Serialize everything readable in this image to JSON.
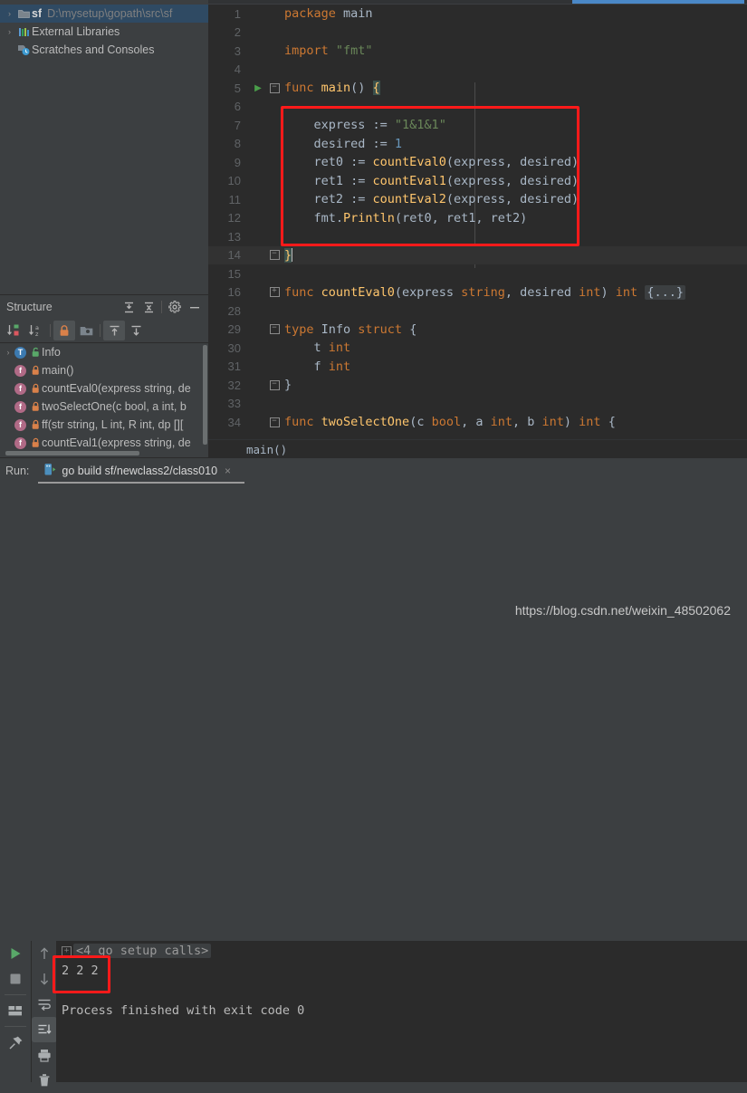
{
  "window": {
    "theme_bg": "#3c3f41",
    "editor_bg": "#2b2b2b",
    "accent": "#4a88c7",
    "annotation_color": "#ff1a1a"
  },
  "project_tree": {
    "items": [
      {
        "arrow": "›",
        "icon": "folder-icon",
        "name": "sf",
        "path": "D:\\mysetup\\gopath\\src\\sf",
        "selected": true
      },
      {
        "arrow": "›",
        "icon": "library-icon",
        "name": "External Libraries",
        "path": "",
        "selected": false
      },
      {
        "arrow": "",
        "icon": "scratches-icon",
        "name": "Scratches and Consoles",
        "path": "",
        "selected": false
      }
    ]
  },
  "structure": {
    "title": "Structure",
    "header_buttons": [
      {
        "name": "expand-all-icon",
        "label": "Expand All"
      },
      {
        "name": "collapse-all-icon",
        "label": "Collapse All"
      },
      {
        "name": "gear-icon",
        "label": "Settings"
      },
      {
        "name": "minimize-icon",
        "label": "Hide"
      }
    ],
    "toolbar_buttons": [
      {
        "name": "sort-by-visibility-icon",
        "label": "Sort by Visibility",
        "active": false
      },
      {
        "name": "sort-alphabetically-icon",
        "label": "Sort Alphabetically",
        "active": false
      },
      {
        "name": "show-non-public-icon",
        "label": "Show Non-Public",
        "active": true
      },
      {
        "name": "group-by-file-icon",
        "label": "Group by File",
        "active": false
      },
      {
        "name": "scroll-from-source-icon",
        "label": "Scroll from Source",
        "active": true
      },
      {
        "name": "scroll-to-source-icon",
        "label": "Scroll to Source",
        "active": false
      }
    ],
    "items": [
      {
        "arrow": "›",
        "kind": "T",
        "kind_class": "t",
        "lock": "public-icon",
        "label": "Info"
      },
      {
        "arrow": "",
        "kind": "f",
        "kind_class": "f",
        "lock": "private-icon",
        "label": "main()"
      },
      {
        "arrow": "",
        "kind": "f",
        "kind_class": "f",
        "lock": "private-icon",
        "label": "countEval0(express string, de"
      },
      {
        "arrow": "",
        "kind": "f",
        "kind_class": "f",
        "lock": "private-icon",
        "label": "twoSelectOne(c bool, a int, b"
      },
      {
        "arrow": "",
        "kind": "f",
        "kind_class": "f",
        "lock": "private-icon",
        "label": "ff(str string, L int, R int, dp []["
      },
      {
        "arrow": "",
        "kind": "f",
        "kind_class": "f",
        "lock": "private-icon",
        "label": "countEval1(express string, de"
      }
    ]
  },
  "editor": {
    "breadcrumb": "main()",
    "lines": [
      {
        "num": "1",
        "gutter": "",
        "fold": "",
        "caret": false,
        "tokens": [
          {
            "t": "package ",
            "c": "kw"
          },
          {
            "t": "main",
            "c": "pln"
          }
        ]
      },
      {
        "num": "2",
        "gutter": "",
        "fold": "",
        "caret": false,
        "tokens": []
      },
      {
        "num": "3",
        "gutter": "",
        "fold": "",
        "caret": false,
        "tokens": [
          {
            "t": "import ",
            "c": "kw"
          },
          {
            "t": "\"fmt\"",
            "c": "str"
          }
        ]
      },
      {
        "num": "4",
        "gutter": "",
        "fold": "",
        "caret": false,
        "tokens": []
      },
      {
        "num": "5",
        "gutter": "run-triangle-icon",
        "fold": "minus",
        "caret": false,
        "tokens": [
          {
            "t": "func ",
            "c": "kw"
          },
          {
            "t": "main",
            "c": "fn"
          },
          {
            "t": "() ",
            "c": "pln"
          },
          {
            "t": "{",
            "c": "brace"
          }
        ]
      },
      {
        "num": "6",
        "gutter": "",
        "fold": "",
        "caret": false,
        "tokens": []
      },
      {
        "num": "7",
        "gutter": "",
        "fold": "",
        "caret": false,
        "tokens": [
          {
            "t": "    express := ",
            "c": "pln"
          },
          {
            "t": "\"1&1&1\"",
            "c": "str"
          }
        ]
      },
      {
        "num": "8",
        "gutter": "",
        "fold": "",
        "caret": false,
        "tokens": [
          {
            "t": "    desired := ",
            "c": "pln"
          },
          {
            "t": "1",
            "c": "num"
          }
        ]
      },
      {
        "num": "9",
        "gutter": "",
        "fold": "",
        "caret": false,
        "tokens": [
          {
            "t": "    ret0 := ",
            "c": "pln"
          },
          {
            "t": "countEval0",
            "c": "fn"
          },
          {
            "t": "(express, desired)",
            "c": "pln"
          }
        ]
      },
      {
        "num": "10",
        "gutter": "",
        "fold": "",
        "caret": false,
        "tokens": [
          {
            "t": "    ret1 := ",
            "c": "pln"
          },
          {
            "t": "countEval1",
            "c": "fn"
          },
          {
            "t": "(express, desired)",
            "c": "pln"
          }
        ]
      },
      {
        "num": "11",
        "gutter": "",
        "fold": "",
        "caret": false,
        "tokens": [
          {
            "t": "    ret2 := ",
            "c": "pln"
          },
          {
            "t": "countEval2",
            "c": "fn"
          },
          {
            "t": "(express, desired)",
            "c": "pln"
          }
        ]
      },
      {
        "num": "12",
        "gutter": "",
        "fold": "",
        "caret": false,
        "tokens": [
          {
            "t": "    fmt.",
            "c": "pln"
          },
          {
            "t": "Println",
            "c": "fn"
          },
          {
            "t": "(ret0, ret1, ret2)",
            "c": "pln"
          }
        ]
      },
      {
        "num": "13",
        "gutter": "",
        "fold": "",
        "caret": false,
        "tokens": []
      },
      {
        "num": "14",
        "gutter": "",
        "fold": "minus",
        "caret": true,
        "tokens": [
          {
            "t": "}",
            "c": "brace"
          },
          {
            "t": "",
            "c": "caret"
          }
        ]
      },
      {
        "num": "15",
        "gutter": "",
        "fold": "",
        "caret": false,
        "tokens": []
      },
      {
        "num": "16",
        "gutter": "",
        "fold": "plus",
        "caret": false,
        "tokens": [
          {
            "t": "func ",
            "c": "kw"
          },
          {
            "t": "countEval0",
            "c": "fn"
          },
          {
            "t": "(express ",
            "c": "pln"
          },
          {
            "t": "string",
            "c": "kw"
          },
          {
            "t": ", desired ",
            "c": "pln"
          },
          {
            "t": "int",
            "c": "kw"
          },
          {
            "t": ") ",
            "c": "pln"
          },
          {
            "t": "int ",
            "c": "kw"
          },
          {
            "t": "{...}",
            "c": "fold"
          }
        ]
      },
      {
        "num": "28",
        "gutter": "",
        "fold": "",
        "caret": false,
        "tokens": []
      },
      {
        "num": "29",
        "gutter": "",
        "fold": "minus",
        "caret": false,
        "tokens": [
          {
            "t": "type ",
            "c": "kw"
          },
          {
            "t": "Info ",
            "c": "pln"
          },
          {
            "t": "struct",
            "c": "kw"
          },
          {
            "t": " {",
            "c": "pln"
          }
        ]
      },
      {
        "num": "30",
        "gutter": "",
        "fold": "",
        "caret": false,
        "tokens": [
          {
            "t": "    t ",
            "c": "pln"
          },
          {
            "t": "int",
            "c": "kw"
          }
        ]
      },
      {
        "num": "31",
        "gutter": "",
        "fold": "",
        "caret": false,
        "tokens": [
          {
            "t": "    f ",
            "c": "pln"
          },
          {
            "t": "int",
            "c": "kw"
          }
        ]
      },
      {
        "num": "32",
        "gutter": "",
        "fold": "minus",
        "caret": false,
        "tokens": [
          {
            "t": "}",
            "c": "pln"
          }
        ]
      },
      {
        "num": "33",
        "gutter": "",
        "fold": "",
        "caret": false,
        "tokens": []
      },
      {
        "num": "34",
        "gutter": "",
        "fold": "minus",
        "caret": false,
        "tokens": [
          {
            "t": "func ",
            "c": "kw"
          },
          {
            "t": "twoSelectOne",
            "c": "fn"
          },
          {
            "t": "(c ",
            "c": "pln"
          },
          {
            "t": "bool",
            "c": "kw"
          },
          {
            "t": ", a ",
            "c": "pln"
          },
          {
            "t": "int",
            "c": "kw"
          },
          {
            "t": ", b ",
            "c": "pln"
          },
          {
            "t": "int",
            "c": "kw"
          },
          {
            "t": ") ",
            "c": "pln"
          },
          {
            "t": "int",
            "c": "kw"
          },
          {
            "t": " {",
            "c": "pln"
          }
        ]
      }
    ]
  },
  "run_window": {
    "label": "Run:",
    "tab": {
      "icon": "go-build-icon",
      "title": "go build sf/newclass2/class010",
      "close": "×"
    },
    "left_toolbar": [
      {
        "name": "rerun-button",
        "glyph": "play",
        "active": false
      },
      {
        "name": "stop-button",
        "glyph": "stop",
        "active": false
      },
      {
        "name": "layout-button",
        "glyph": "layout",
        "active": false
      },
      {
        "name": "pin-button",
        "glyph": "pin",
        "active": false
      }
    ],
    "second_toolbar": [
      {
        "name": "up-arrow-button",
        "glyph": "up",
        "active": false
      },
      {
        "name": "down-arrow-button",
        "glyph": "down",
        "active": false
      },
      {
        "name": "soft-wrap-button",
        "glyph": "wrap",
        "active": false
      },
      {
        "name": "scroll-to-end-button",
        "glyph": "scroll-end",
        "active": true
      },
      {
        "name": "print-button",
        "glyph": "print",
        "active": false
      },
      {
        "name": "clear-all-button",
        "glyph": "trash",
        "active": false
      }
    ],
    "console_lines": [
      {
        "type": "folded",
        "text": "<4 go setup calls>"
      },
      {
        "type": "output",
        "text": "2 2 2"
      },
      {
        "type": "blank",
        "text": ""
      },
      {
        "type": "output",
        "text": "Process finished with exit code 0"
      }
    ]
  },
  "annotations": {
    "editor_box_label": "red-highlight-code-block",
    "console_box_label": "red-highlight-output"
  },
  "watermark": "https://blog.csdn.net/weixin_48502062"
}
